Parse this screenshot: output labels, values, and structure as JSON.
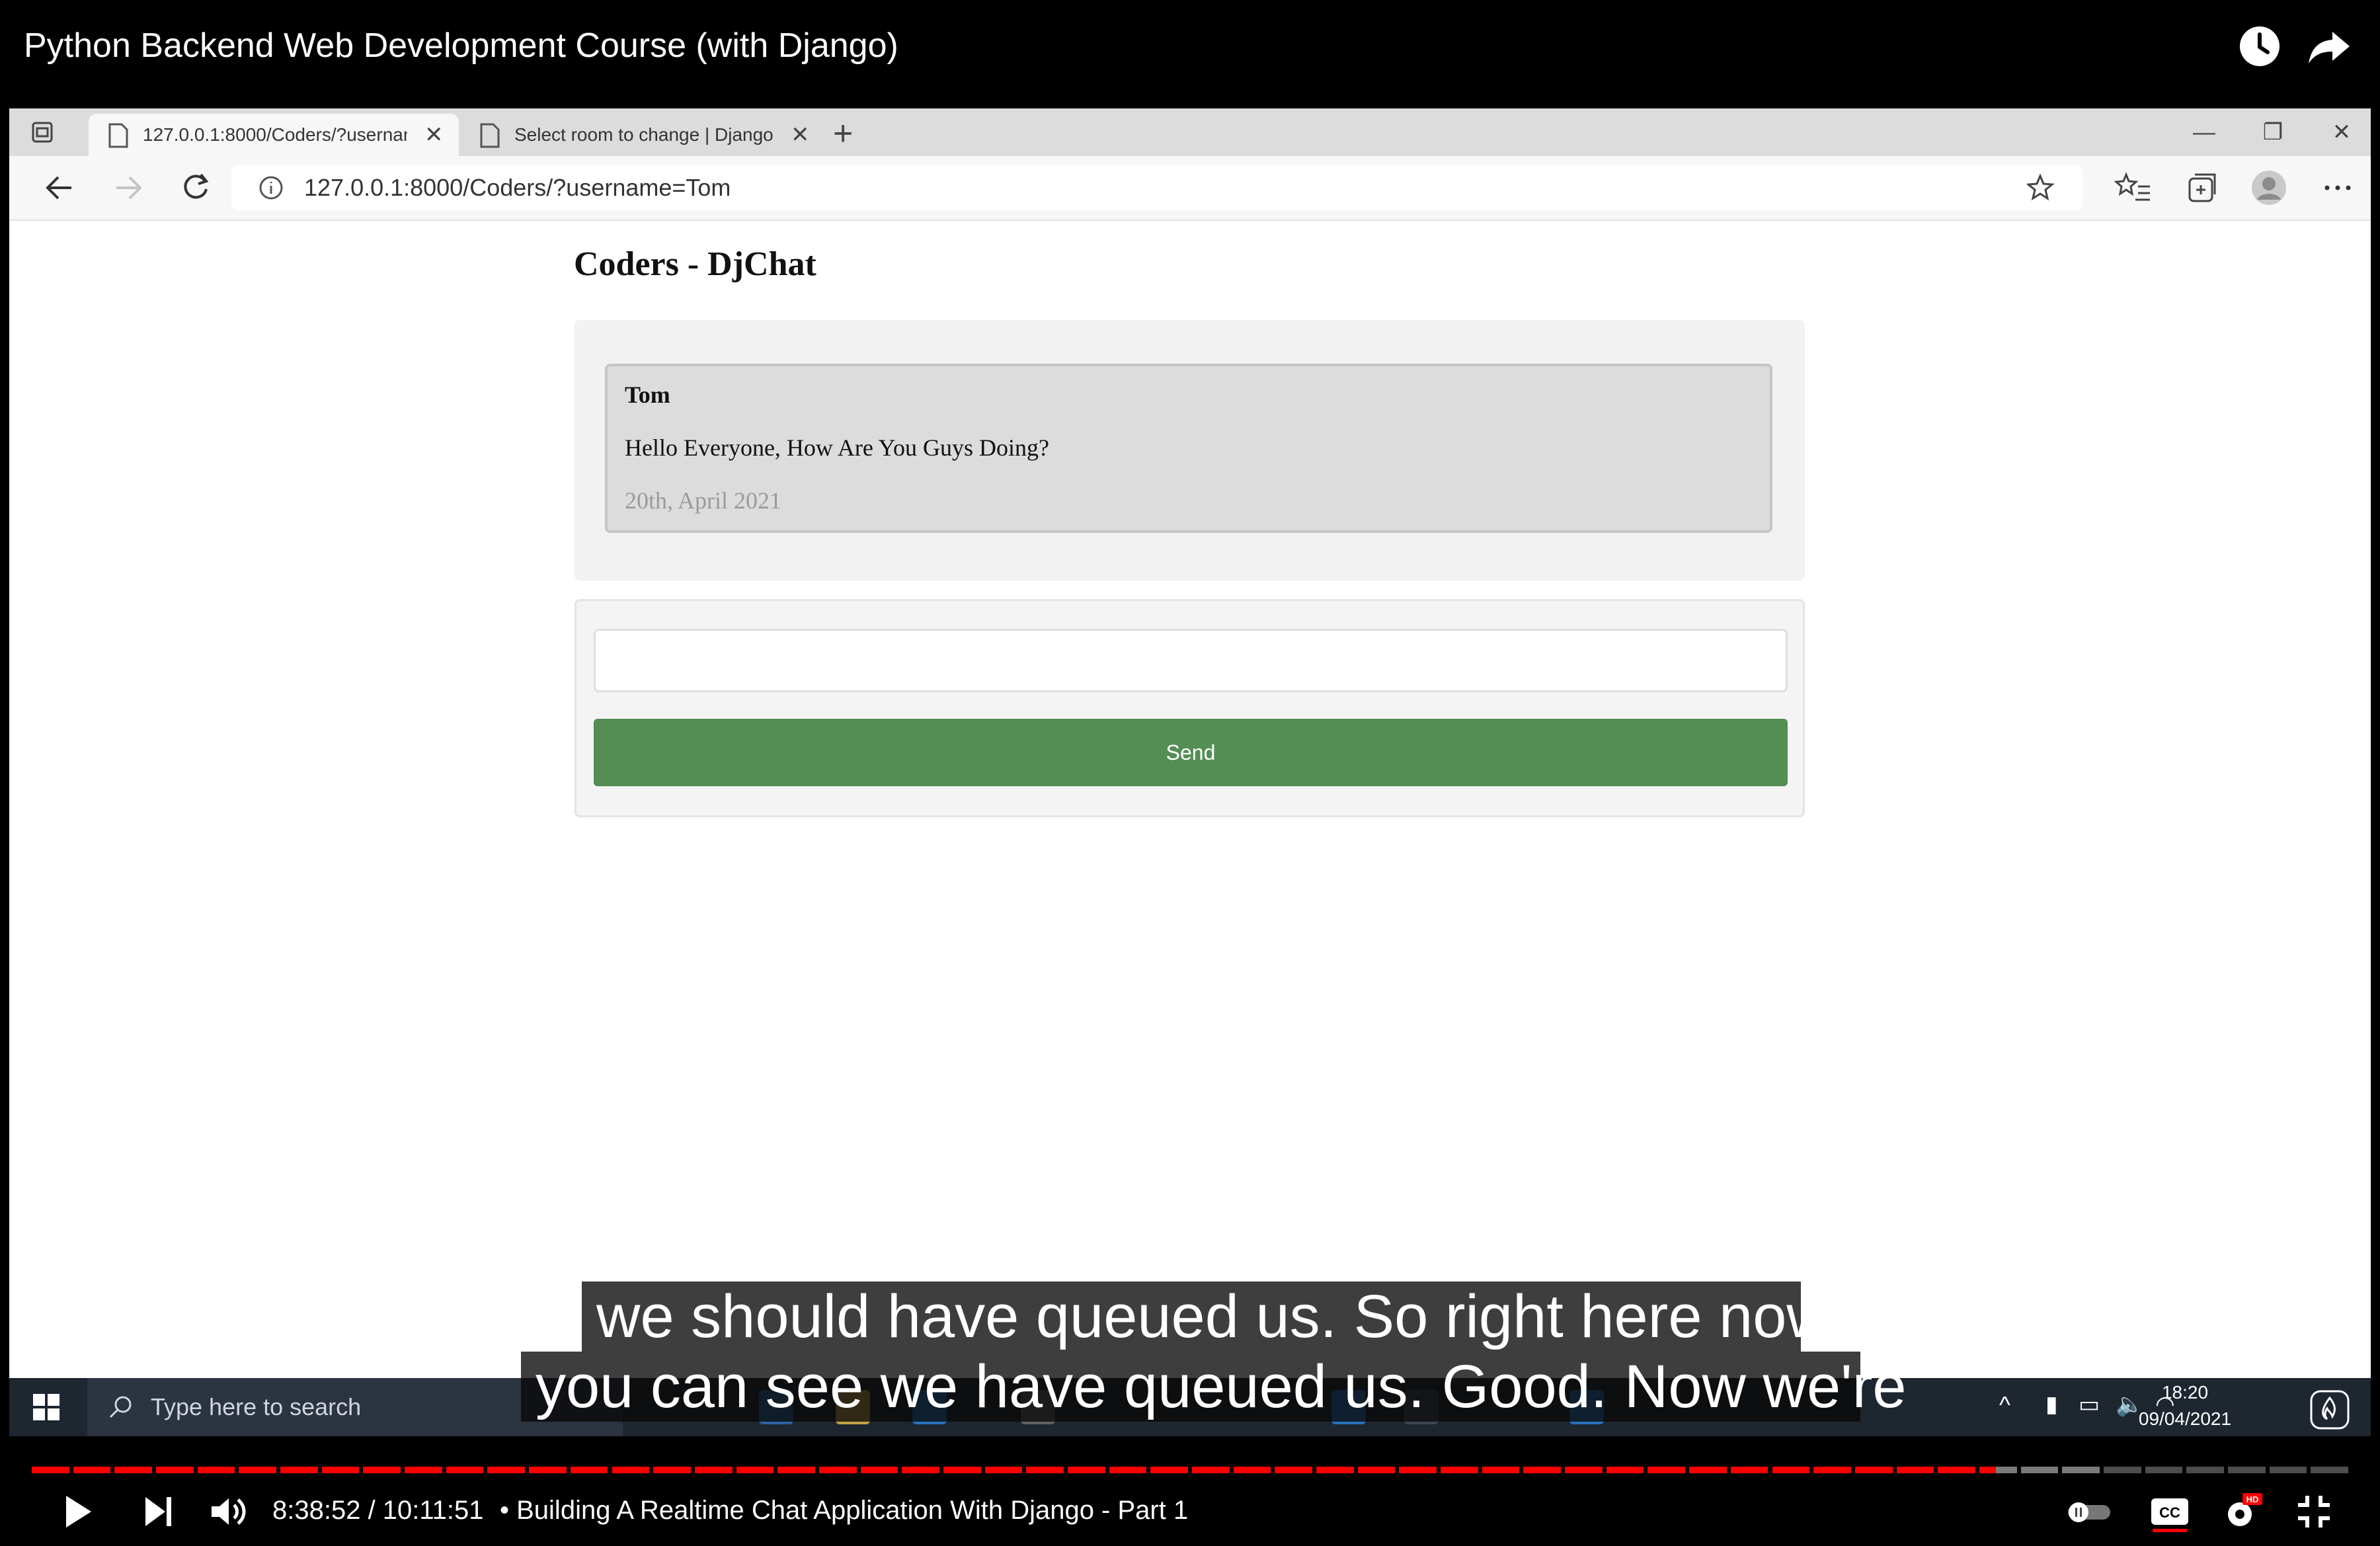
{
  "video": {
    "title": "Python Backend Web Development Course (with Django)"
  },
  "browser": {
    "tabs": [
      {
        "label": "127.0.0.1:8000/Coders/?usernam",
        "active": true
      },
      {
        "label": "Select room to change | Django",
        "active": false
      }
    ],
    "tab_close_glyph": "✕",
    "new_tab_glyph": "+",
    "address": "127.0.0.1:8000/Coders/?username=Tom"
  },
  "page": {
    "heading": "Coders - DjChat",
    "messages": [
      {
        "author": "Tom",
        "text": "Hello Everyone, How Are You Guys Doing?",
        "date": "20th, April 2021"
      }
    ],
    "input_value": "",
    "send_label": "Send"
  },
  "taskbar": {
    "search_placeholder": "Type here to search",
    "time": "18:20",
    "date": "09/04/2021"
  },
  "captions": {
    "line1": "we should have queued us. So right here now",
    "line2": "you can see we have queued us. Good. Now we're"
  },
  "player": {
    "time": "8:38:52 / 10:11:51",
    "chapter": "• Building A Realtime Chat Application With Django - Part 1",
    "progress": 0.848,
    "colors": {
      "played": "#ff0000",
      "buffered": "#7a7a7a",
      "unplayed": "#4d4d4d"
    }
  }
}
